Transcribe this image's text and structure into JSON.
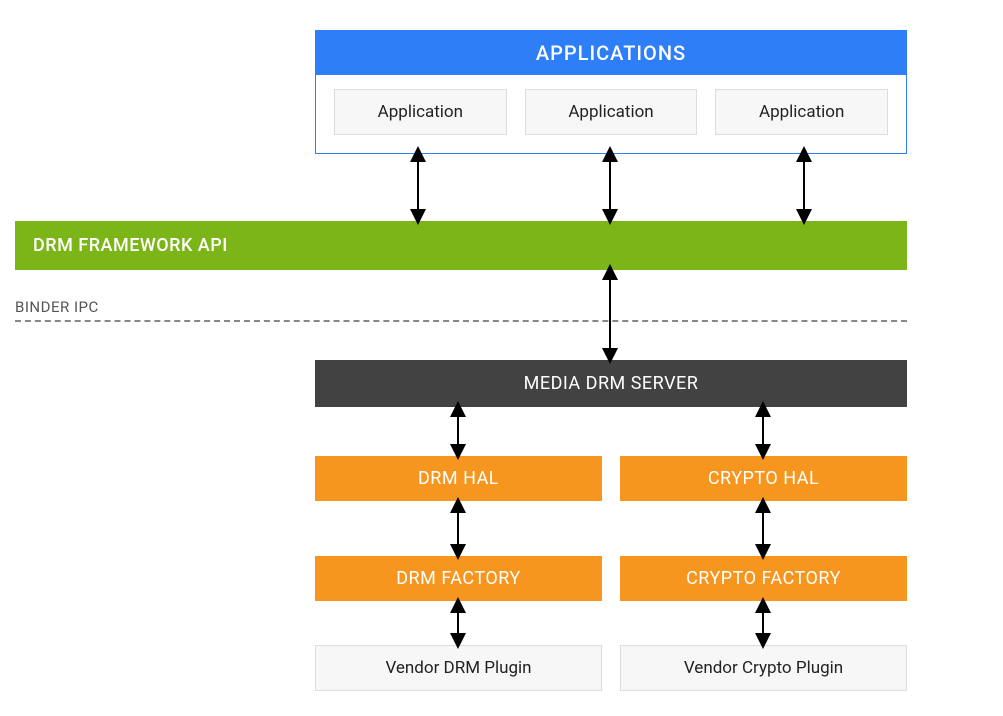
{
  "applications": {
    "header": "APPLICATIONS",
    "items": [
      "Application",
      "Application",
      "Application"
    ]
  },
  "drm_api": {
    "label": "DRM FRAMEWORK API"
  },
  "binder": {
    "label": "BINDER IPC"
  },
  "media_server": {
    "label": "MEDIA DRM SERVER"
  },
  "hal": {
    "drm": "DRM HAL",
    "crypto": "CRYPTO HAL"
  },
  "factory": {
    "drm": "DRM FACTORY",
    "crypto": "CRYPTO FACTORY"
  },
  "vendor": {
    "drm": "Vendor DRM Plugin",
    "crypto": "Vendor Crypto Plugin"
  }
}
